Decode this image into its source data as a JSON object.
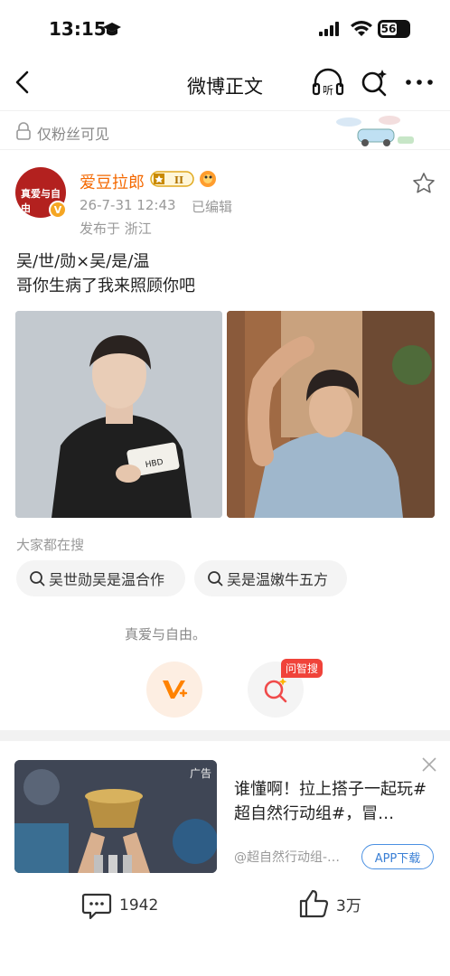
{
  "status": {
    "time": "13:15",
    "battery": "56"
  },
  "nav": {
    "title": "微博正文"
  },
  "visibility": {
    "label": "仅粉丝可见"
  },
  "post": {
    "author": "爱豆拉郎",
    "avatar_text": "真爱与自由",
    "level": "II",
    "time": "26-7-31 12:43",
    "edited": "已编辑",
    "location": "发布于 浙江",
    "text_line1": "吴/世/勋×吴/是/温",
    "text_line2": "哥你生病了我来照顾你吧",
    "photo1_caption": "HBD"
  },
  "search_hint": {
    "title": "大家都在搜",
    "chips": [
      "吴世勋吴是温合作",
      "吴是温嫩牛五方"
    ]
  },
  "interaction": {
    "slogan": "真爱与自由。",
    "ask_tag": "问智搜"
  },
  "ad": {
    "tag": "广告",
    "text": "谁懂啊！拉上搭子一起玩#超自然行动组#，冒…",
    "source": "@超自然行动组-…",
    "download": "APP下载"
  },
  "bottom": {
    "comments": "1942",
    "likes": "3万"
  },
  "colors": {
    "author": "#f46800",
    "accent": "#ff8200",
    "ad_link": "#3a7fd5",
    "tag_red": "#f0433a"
  }
}
